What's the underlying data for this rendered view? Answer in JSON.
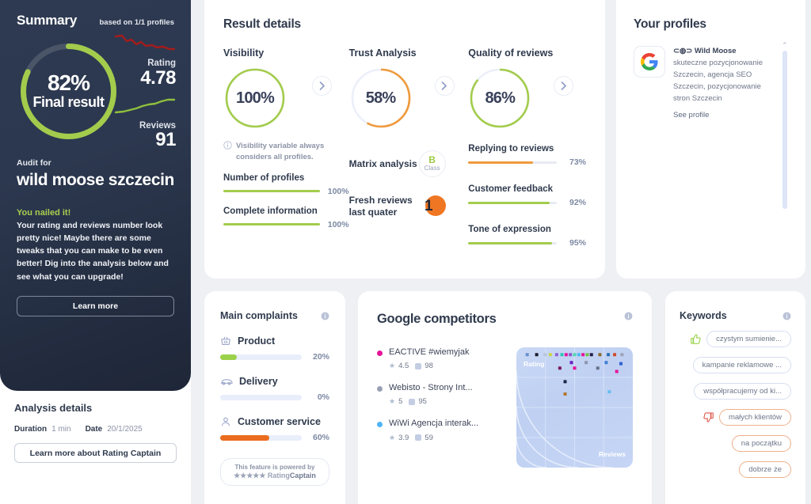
{
  "colors": {
    "green": "#a3cc4c",
    "orange": "#ef7723",
    "dark": "#2c384f",
    "grey_track": "#e7ebf3",
    "accent_blue": "#7d8aa3"
  },
  "sidebar": {
    "summary_title": "Summary",
    "based_on": "based on 1/1 profiles",
    "gauge": {
      "percent": "82%",
      "label": "Final result",
      "value": 82
    },
    "rating": {
      "label": "Rating",
      "value": "4.78",
      "trend": "down"
    },
    "reviews": {
      "label": "Reviews",
      "value": "91",
      "trend": "up"
    },
    "audit_for_label": "Audit for",
    "audit_name": "wild moose szczecin",
    "nailed_title": "You nailed it!",
    "nailed_body": "Your rating and reviews number look pretty nice! Maybe there are some tweaks that you can make to be even better! Dig into the analysis below and see what you can upgrade!",
    "learn_more": "Learn more",
    "analysis_title": "Analysis details",
    "duration_label": "Duration",
    "duration_value": "1 min",
    "date_label": "Date",
    "date_value": "20/1/2025",
    "rating_captain_btn": "Learn more about Rating Captain"
  },
  "result_details": {
    "title": "Result details",
    "metrics": [
      {
        "name": "Visibility",
        "percent": "100%",
        "value": 100,
        "color": "#a3cc4c"
      },
      {
        "name": "Trust Analysis",
        "percent": "58%",
        "value": 58,
        "color": "#ef9a3c"
      },
      {
        "name": "Quality of reviews",
        "percent": "86%",
        "value": 86,
        "color": "#a3cc4c"
      }
    ],
    "visibility_note": "Visibility variable always considers all profiles.",
    "visibility_bars": [
      {
        "label": "Number of profiles",
        "percent": "100%",
        "value": 100,
        "color": "#a3cc4c"
      },
      {
        "label": "Complete information",
        "percent": "100%",
        "value": 100,
        "color": "#a3cc4c"
      }
    ],
    "trust_rows": [
      {
        "label": "Matrix analysis",
        "badge_letter": "B",
        "badge_word": "Class"
      },
      {
        "label": "Fresh reviews last quater",
        "value": "1"
      }
    ],
    "quality_bars": [
      {
        "label": "Replying to reviews",
        "percent": "73%",
        "value": 73,
        "color": "#ef9a3c"
      },
      {
        "label": "Customer feedback",
        "percent": "92%",
        "value": 92,
        "color": "#a3cc4c"
      },
      {
        "label": "Tone of expression",
        "percent": "95%",
        "value": 95,
        "color": "#a3cc4c"
      }
    ]
  },
  "your_profiles": {
    "title": "Your profiles",
    "provider_icon": "google-icon",
    "profile_name": "⊂◍⊃ Wild Moose",
    "profile_desc": "skuteczne pozycjonowanie Szczecin, agencja SEO Szczecin, pozycjonowanie stron Szczecin",
    "see_profile": "See profile"
  },
  "main_complaints": {
    "title": "Main complaints",
    "items": [
      {
        "icon": "basket-icon",
        "label": "Product",
        "percent": "20%",
        "value": 20,
        "color": "#9bd14a"
      },
      {
        "icon": "truck-icon",
        "label": "Delivery",
        "percent": "0%",
        "value": 0,
        "color": "#9bd14a"
      },
      {
        "icon": "person-icon",
        "label": "Customer service",
        "percent": "60%",
        "value": 60,
        "color": "#ea6d1f"
      }
    ],
    "powered_line1": "This feature is powered by",
    "powered_line2_stars": "★★★★★",
    "powered_line2_brand_a": "Rating",
    "powered_line2_brand_b": "Captain"
  },
  "google_competitors": {
    "title": "Google competitors",
    "competitors": [
      {
        "name": "EACTIVE #wiemyjak",
        "rating": "4.5",
        "reviews": "98",
        "color": "#e6139c"
      },
      {
        "name": "Webisto - Strony Int...",
        "rating": "5",
        "reviews": "95",
        "color": "#98a0b3"
      },
      {
        "name": "WiWi Agencja interak...",
        "rating": "3.9",
        "reviews": "59",
        "color": "#4fb4f5"
      }
    ],
    "axis_y": "Rating",
    "axis_x": "Reviews"
  },
  "chart_data": {
    "type": "scatter",
    "title": "Google competitors",
    "xlabel": "Reviews",
    "ylabel": "Rating",
    "xlim": [
      0,
      100
    ],
    "ylim": [
      0,
      100
    ],
    "grid": true,
    "points": [
      {
        "x": 5,
        "y": 97,
        "color": "#6a8fd0"
      },
      {
        "x": 14,
        "y": 97,
        "color": "#1b1b2e"
      },
      {
        "x": 22,
        "y": 97,
        "color": "#b7c4d9"
      },
      {
        "x": 27,
        "y": 97,
        "color": "#c9d44a"
      },
      {
        "x": 33,
        "y": 97,
        "color": "#8e63d8"
      },
      {
        "x": 38,
        "y": 97,
        "color": "#2ec4b6"
      },
      {
        "x": 42,
        "y": 97,
        "color": "#e6139c"
      },
      {
        "x": 46,
        "y": 97,
        "color": "#8f56c9"
      },
      {
        "x": 50,
        "y": 97,
        "color": "#52d6b0"
      },
      {
        "x": 54,
        "y": 97,
        "color": "#4fb4f5"
      },
      {
        "x": 58,
        "y": 97,
        "color": "#e6139c"
      },
      {
        "x": 62,
        "y": 97,
        "color": "#6fc24a"
      },
      {
        "x": 66,
        "y": 97,
        "color": "#241f45"
      },
      {
        "x": 74,
        "y": 97,
        "color": "#8a6a2c"
      },
      {
        "x": 82,
        "y": 97,
        "color": "#2b6fb5"
      },
      {
        "x": 88,
        "y": 97,
        "color": "#d14a2c"
      },
      {
        "x": 95,
        "y": 97,
        "color": "#9aa3b6"
      },
      {
        "x": 47,
        "y": 90,
        "color": "#6a1fc9"
      },
      {
        "x": 61,
        "y": 90,
        "color": "#8b95ab"
      },
      {
        "x": 80,
        "y": 90,
        "color": "#3b7fd4"
      },
      {
        "x": 94,
        "y": 89,
        "color": "#2f5fd0"
      },
      {
        "x": 36,
        "y": 85,
        "color": "#7a1b55"
      },
      {
        "x": 50,
        "y": 85,
        "color": "#e6139c"
      },
      {
        "x": 72,
        "y": 85,
        "color": "#6a7288"
      },
      {
        "x": 90,
        "y": 82,
        "color": "#e6139c"
      },
      {
        "x": 41,
        "y": 73,
        "color": "#1b2545"
      },
      {
        "x": 41,
        "y": 62,
        "color": "#b2762c"
      },
      {
        "x": 83,
        "y": 64,
        "color": "#69bdf0"
      }
    ]
  },
  "keywords": {
    "title": "Keywords",
    "positive": [
      "czystym sumienie...",
      "kampanie reklamowe ...",
      "współpracujemy od ki..."
    ],
    "negative": [
      "małych klientów",
      "na początku",
      "dobrze że"
    ],
    "thumb_up_icon": "thumb-up-icon",
    "thumb_down_icon": "thumb-down-icon"
  }
}
